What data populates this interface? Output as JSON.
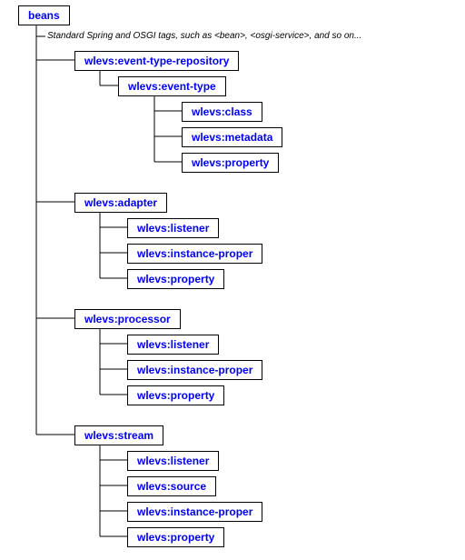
{
  "root": {
    "label": "beans"
  },
  "description": "Standard Spring and OSGI tags, such as <bean>, <osgi-service>, and so on...",
  "blocks": {
    "repo": {
      "label": "wlevs:event-type-repository",
      "children": {
        "etype": {
          "label": "wlevs:event-type",
          "children": {
            "class": "wlevs:class",
            "metadata": "wlevs:metadata",
            "property": "wlevs:property"
          }
        }
      }
    },
    "adapter": {
      "label": "wlevs:adapter",
      "children": {
        "listener": "wlevs:listener",
        "instprop": "wlevs:instance-proper",
        "property": "wlevs:property"
      }
    },
    "processor": {
      "label": "wlevs:processor",
      "children": {
        "listener": "wlevs:listener",
        "instprop": "wlevs:instance-proper",
        "property": "wlevs:property"
      }
    },
    "stream": {
      "label": "wlevs:stream",
      "children": {
        "listener": "wlevs:listener",
        "source": "wlevs:source",
        "instprop": "wlevs:instance-proper",
        "property": "wlevs:property"
      }
    }
  },
  "chart_data": {
    "type": "tree",
    "title": "",
    "root": "beans",
    "children": [
      {
        "name": "wlevs:event-type-repository",
        "children": [
          {
            "name": "wlevs:event-type",
            "children": [
              "wlevs:class",
              "wlevs:metadata",
              "wlevs:property"
            ]
          }
        ]
      },
      {
        "name": "wlevs:adapter",
        "children": [
          "wlevs:listener",
          "wlevs:instance-proper",
          "wlevs:property"
        ]
      },
      {
        "name": "wlevs:processor",
        "children": [
          "wlevs:listener",
          "wlevs:instance-proper",
          "wlevs:property"
        ]
      },
      {
        "name": "wlevs:stream",
        "children": [
          "wlevs:listener",
          "wlevs:source",
          "wlevs:instance-proper",
          "wlevs:property"
        ]
      }
    ],
    "note": "Standard Spring and OSGI tags, such as <bean>, <osgi-service>, and so on..."
  }
}
